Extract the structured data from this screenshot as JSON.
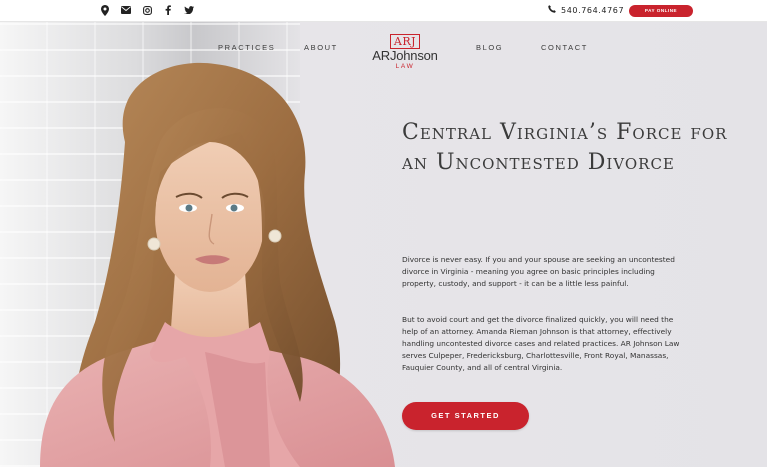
{
  "topbar": {
    "icons": [
      "map-pin-icon",
      "envelope-icon",
      "instagram-icon",
      "facebook-icon",
      "twitter-icon"
    ],
    "phone": "540.764.4767",
    "pay_label": "PAY ONLINE"
  },
  "nav": {
    "items": [
      "PRACTICES",
      "ABOUT",
      "BLOG",
      "CONTACT"
    ],
    "logo": {
      "mark": "ARJ",
      "name": "ARJohnson",
      "sub": "LAW"
    }
  },
  "hero": {
    "headline": "Central Virginia’s Force for an Uncontested Divorce",
    "paragraphs": [
      "Divorce is never easy. If you and your spouse are seeking an uncontested divorce in Virginia - meaning you agree on basic principles including property, custody, and support - it can be a little less painful.",
      "But to avoid court and get the divorce finalized quickly, you will need the help of an attorney. Amanda Rieman Johnson is that attorney, effectively handling uncontested divorce cases and related practices. AR Johnson Law serves Culpeper, Fredericksburg, Charlottesville, Front Royal, Manassas, Fauquier County, and all of central Virginia."
    ],
    "cta_label": "GET STARTED"
  },
  "colors": {
    "accent": "#c9232d",
    "text": "#333333",
    "hero_bg": "#e7e5e9"
  }
}
